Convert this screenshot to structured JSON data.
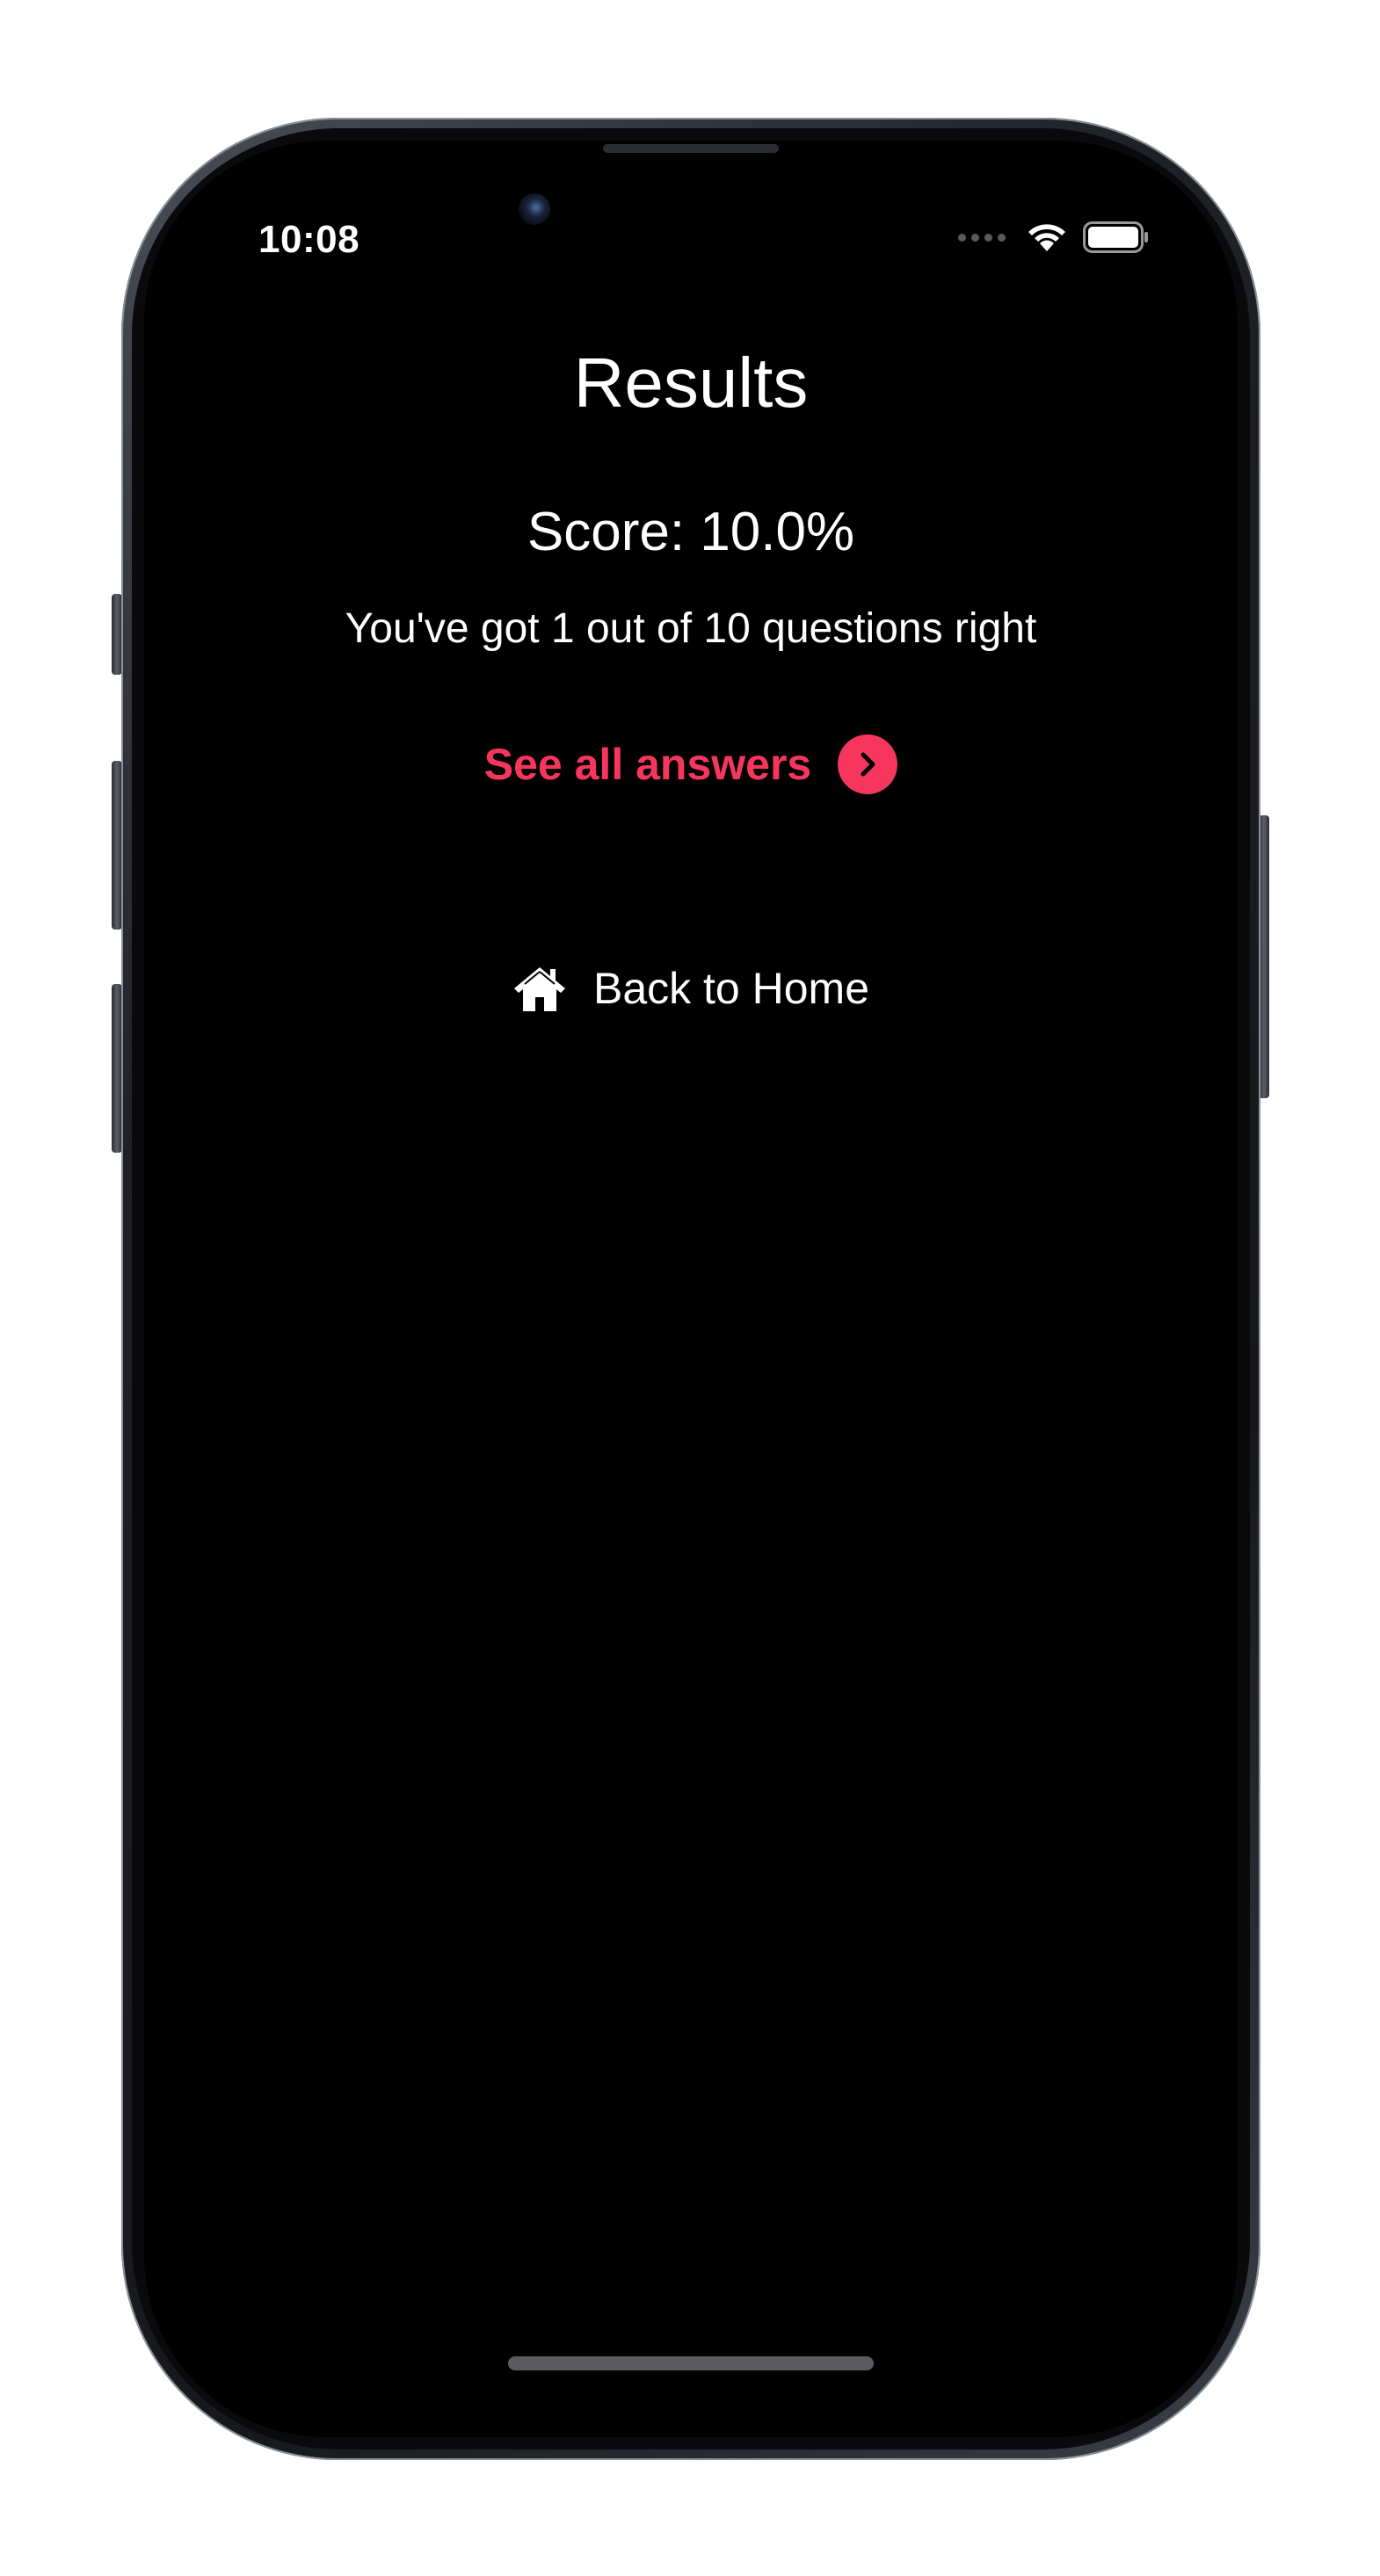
{
  "status_bar": {
    "time": "10:08",
    "icons": [
      "cellular-signal-icon",
      "wifi-icon",
      "battery-icon"
    ]
  },
  "results": {
    "title": "Results",
    "score_text": "Score: 10.0%",
    "summary_text": "You've got 1 out of 10 questions right"
  },
  "actions": {
    "see_all_answers_label": "See all answers",
    "back_home_label": "Back to Home"
  },
  "colors": {
    "accent": "#f7365e",
    "background": "#000000",
    "text": "#ffffff"
  }
}
